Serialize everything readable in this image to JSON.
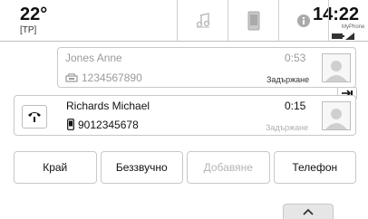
{
  "status": {
    "temperature": "22°",
    "source": "[TP]",
    "time": "14:22",
    "phone_label": "MyPhone"
  },
  "calls": [
    {
      "name": "Jones Anne",
      "number": "1234567890",
      "duration": "0:53",
      "state": "Задържане",
      "number_type_icon": "office-phone-icon"
    },
    {
      "name": "Richards Michael",
      "number": "9012345678",
      "duration": "0:15",
      "state": "Задържане",
      "number_type_icon": "mobile-phone-icon"
    }
  ],
  "swap_label": "⟲",
  "actions": [
    {
      "label": "Край",
      "enabled": true
    },
    {
      "label": "Беззвучно",
      "enabled": true
    },
    {
      "label": "Добавяне",
      "enabled": false
    },
    {
      "label": "Телефон",
      "enabled": true
    }
  ],
  "colors": {
    "border": "#c8c8c8",
    "dim_text": "#9a9a9a",
    "disabled_text": "#b5b5b5"
  }
}
